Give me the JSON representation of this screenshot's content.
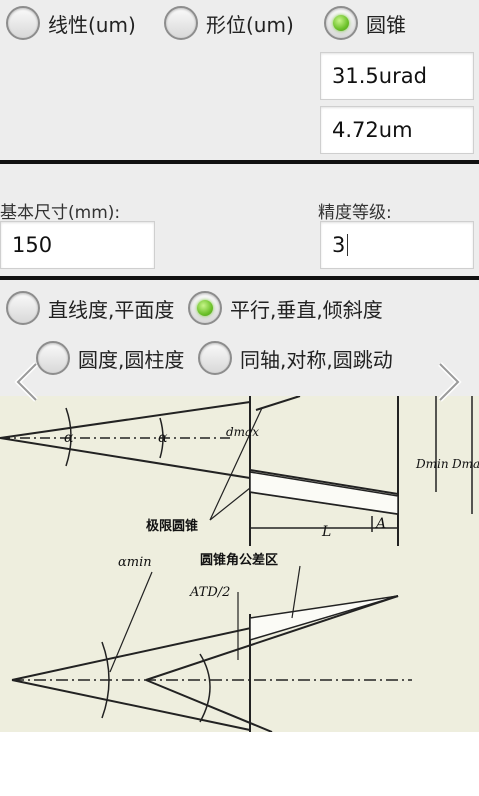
{
  "mode_radios": [
    {
      "label": "线性(um)",
      "selected": false
    },
    {
      "label": "形位(um)",
      "selected": false
    },
    {
      "label": "圆锥",
      "selected": true
    }
  ],
  "cone_results": {
    "angle_tolerance": "31.5urad",
    "diameter_tolerance": "4.72um"
  },
  "basic_size": {
    "label": "基本尺寸(mm):",
    "value": "150"
  },
  "precision_grade": {
    "label": "精度等级:",
    "value": "3"
  },
  "geometry_radios": [
    {
      "label": "直线度,平面度",
      "selected": false
    },
    {
      "label": "平行,垂直,倾斜度",
      "selected": true
    },
    {
      "label": "圆度,圆柱度",
      "selected": false
    },
    {
      "label": "同轴,对称,圆跳动",
      "selected": false
    }
  ],
  "nav": {
    "prev_icon": "chevron-left-icon",
    "next_icon": "chevron-right-icon"
  },
  "drawing_labels": {
    "alpha_1": "α",
    "alpha_2": "α",
    "d_max": "dmax",
    "D_min": "Dmin",
    "D_max": "Dmax",
    "limit_cone": "极限圆锥",
    "L": "L",
    "A": "A",
    "alpha_min": "αmin",
    "cone_angle_zone": "圆锥角公差区",
    "AT_D": "ATD/2"
  },
  "colors": {
    "panel_bg": "#ededed",
    "drawing_bg": "#eeeede",
    "radio_selected": "#6cc12a",
    "divider": "#111111"
  }
}
